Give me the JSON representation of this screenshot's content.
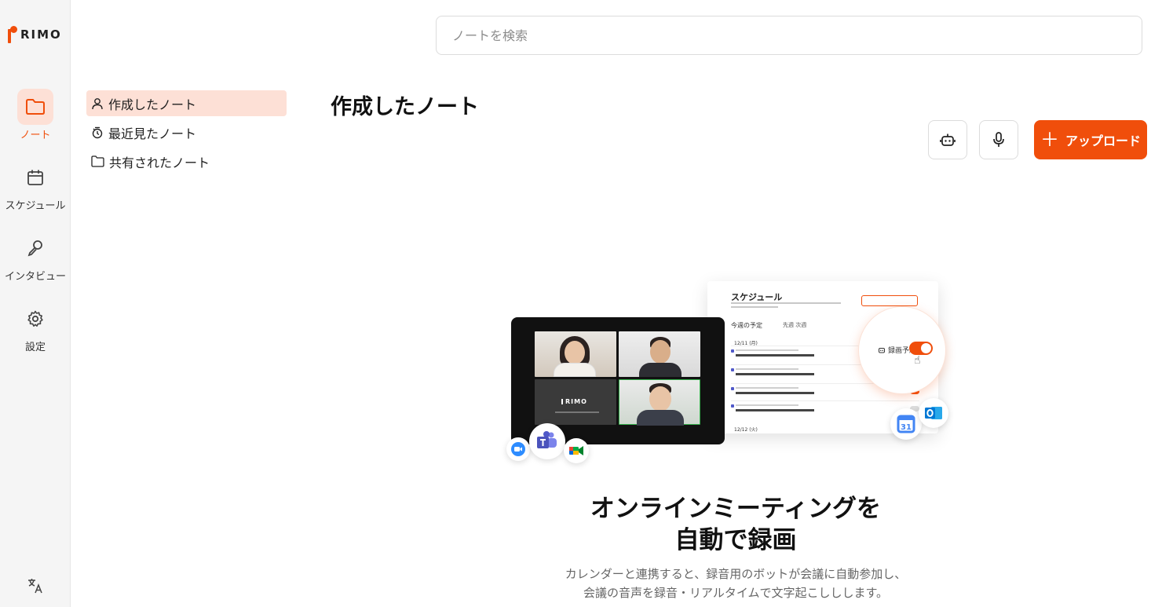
{
  "brand": {
    "name": "RIMO",
    "accent": "#f04e0b",
    "accent_soft": "#fde0d6"
  },
  "rail": {
    "items": [
      {
        "label": "ノート",
        "icon": "folder-icon",
        "active": true
      },
      {
        "label": "スケジュール",
        "icon": "calendar-icon",
        "active": false
      },
      {
        "label": "インタビュー",
        "icon": "microphone-pen-icon",
        "active": false
      },
      {
        "label": "設定",
        "icon": "gear-icon",
        "active": false
      }
    ],
    "language_icon": "translate-icon"
  },
  "subnav": {
    "items": [
      {
        "label": "作成したノート",
        "icon": "user-icon",
        "active": true
      },
      {
        "label": "最近見たノート",
        "icon": "recent-icon",
        "active": false
      },
      {
        "label": "共有されたノート",
        "icon": "folder-icon",
        "active": false
      }
    ]
  },
  "search": {
    "placeholder": "ノートを検索"
  },
  "main": {
    "title": "作成したノート",
    "buttons": {
      "bot_icon": "bot-icon",
      "mic_icon": "microphone-icon",
      "upload_label": "アップロード"
    }
  },
  "illustration": {
    "schedule_title": "スケジュール",
    "week_label": "今週の予定",
    "week_nav": "先週 次週",
    "day_1": "12/11 (月)",
    "day_2": "12/12 (火)",
    "toggle_label": "録画予約",
    "tablet_logo": "RIMO"
  },
  "hero": {
    "title_line1": "オンラインミーティングを",
    "title_line2": "自動で録画",
    "desc_line1": "カレンダーと連携すると、録音用のボットが会議に自動参加し、",
    "desc_line2": "会議の音声を録音・リアルタイムで文字起こししします。"
  }
}
